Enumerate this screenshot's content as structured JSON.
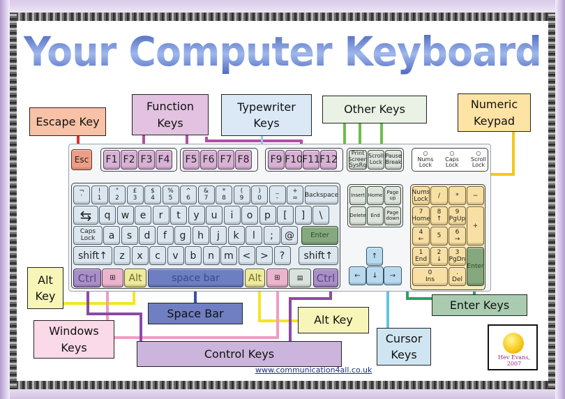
{
  "title": "Your Computer Keyboard",
  "labels": {
    "escape": "Escape Key",
    "function": [
      "Function",
      "Keys"
    ],
    "typewriter": [
      "Typewriter",
      "Keys"
    ],
    "other": "Other Keys",
    "numeric": [
      "Numeric",
      "Keypad"
    ],
    "alt_left": [
      "Alt",
      "Key"
    ],
    "space": "Space Bar",
    "windows": [
      "Windows",
      "Keys"
    ],
    "control": "Control Keys",
    "alt_right": "Alt Key",
    "cursor": [
      "Cursor",
      "Keys"
    ],
    "enter": "Enter Keys"
  },
  "keys": {
    "esc": "Esc",
    "function_row": [
      "F1",
      "F2",
      "F3",
      "F4",
      "F5",
      "F6",
      "F7",
      "F8",
      "F9",
      "F10",
      "F11",
      "F12"
    ],
    "other_keys": [
      {
        "top": "Print Screen",
        "bottom": "SysRq"
      },
      {
        "top": "Scroll",
        "bottom": "Lock"
      },
      {
        "top": "Pause",
        "bottom": "Break"
      }
    ],
    "lock_lights": [
      "Nums Lock",
      "Caps Lock",
      "Scroll Lock"
    ],
    "number_row": [
      {
        "top": "¬",
        "bottom": "`"
      },
      {
        "top": "!",
        "bottom": "1"
      },
      {
        "top": "\"",
        "bottom": "2"
      },
      {
        "top": "£",
        "bottom": "3"
      },
      {
        "top": "$",
        "bottom": "4"
      },
      {
        "top": "%",
        "bottom": "5"
      },
      {
        "top": "^",
        "bottom": "6"
      },
      {
        "top": "&",
        "bottom": "7"
      },
      {
        "top": "*",
        "bottom": "8"
      },
      {
        "top": "(",
        "bottom": "9"
      },
      {
        "top": ")",
        "bottom": "0"
      },
      {
        "top": "_",
        "bottom": "-"
      },
      {
        "top": "+",
        "bottom": "="
      }
    ],
    "backspace": "Backspace",
    "qwerty_row": [
      "q",
      "w",
      "e",
      "r",
      "t",
      "y",
      "u",
      "i",
      "o",
      "p",
      "[",
      "]",
      "\\"
    ],
    "caps_lock": [
      "Caps",
      "Lock"
    ],
    "home_row": [
      "a",
      "s",
      "d",
      "f",
      "g",
      "h",
      "j",
      "k",
      "l",
      ";",
      "@"
    ],
    "enter": "Enter",
    "shift": "shift",
    "bottom_row": [
      "z",
      "x",
      "c",
      "v",
      "b",
      "n",
      "m",
      "<",
      ">",
      "?"
    ],
    "ctrl": "Ctrl",
    "alt": "Alt",
    "space_bar": "space bar",
    "nav_cluster": [
      [
        "Insert",
        "Home",
        "Page up"
      ],
      [
        "Delete",
        "End",
        "Page down"
      ]
    ],
    "arrows": {
      "up": "↑",
      "down": "↓",
      "left": "←",
      "right": "→"
    },
    "numpad": {
      "row1": [
        "Nums Lock",
        "/",
        "*",
        "−"
      ],
      "row2": [
        {
          "top": "7",
          "bottom": "Home"
        },
        {
          "top": "8",
          "bottom": "↑"
        },
        {
          "top": "9",
          "bottom": "PgUp"
        }
      ],
      "plus": "+",
      "row3": [
        {
          "top": "4",
          "bottom": "←"
        },
        {
          "top": "5",
          "bottom": ""
        },
        {
          "top": "6",
          "bottom": "→"
        }
      ],
      "row4": [
        {
          "top": "1",
          "bottom": "End"
        },
        {
          "top": "2",
          "bottom": "↓"
        },
        {
          "top": "3",
          "bottom": "PgDn"
        }
      ],
      "enter": "Enter",
      "zero": {
        "top": "0",
        "bottom": "Ins"
      },
      "dot": {
        "top": ".",
        "bottom": "Del"
      }
    }
  },
  "footer_url": "www.communication4all.co.uk",
  "logo_text": "Hev Evans, 2007",
  "colors": {
    "escape": "#f7c2a6",
    "function": "#e2c2e0",
    "typewriter": "#dbe9f7",
    "other": "#eaf2e6",
    "numeric": "#fde3a4",
    "alt": "#f7f5b8",
    "space": "#6f7fc2",
    "windows": "#fad9e8",
    "control": "#cbb5dc",
    "cursor": "#cfe6f2",
    "enter": "#a9ccb0"
  }
}
